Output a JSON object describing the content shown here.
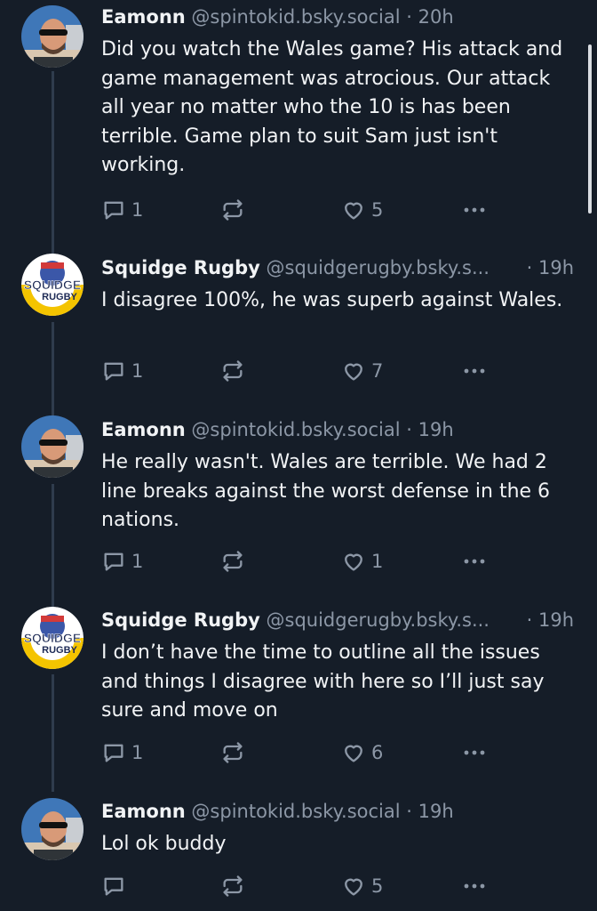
{
  "colors": {
    "background": "#151d28",
    "text": "#f1f3f5",
    "muted": "#8c97a6",
    "thread_line": "#2f3c4d"
  },
  "posts": [
    {
      "author": "Eamonn",
      "handle": "@spintokid.bsky.social",
      "sep": "·",
      "time": "20h",
      "text": "Did you watch the Wales game? His attack and game management was atrocious. Our attack all year no matter who the 10 is has been terrible. Game plan to suit Sam just isn't working.",
      "replies": "1",
      "reposts": "",
      "likes": "5",
      "avatar": "eamonn-avatar"
    },
    {
      "author": "Squidge Rugby",
      "handle": "@squidgerugby.bsky.s...",
      "sep": "·",
      "time": "19h",
      "text": "I disagree 100%, he was superb against Wales.",
      "replies": "1",
      "reposts": "",
      "likes": "7",
      "avatar": "squidge-logo-avatar",
      "avatar_text": [
        "SQUIDGE",
        "RUGBY"
      ]
    },
    {
      "author": "Eamonn",
      "handle": "@spintokid.bsky.social",
      "sep": "·",
      "time": "19h",
      "text": "He really wasn't. Wales are terrible. We had 2 line breaks against the worst defense in the 6 nations.",
      "replies": "1",
      "reposts": "",
      "likes": "1",
      "avatar": "eamonn-avatar"
    },
    {
      "author": "Squidge Rugby",
      "handle": "@squidgerugby.bsky.s...",
      "sep": "·",
      "time": "19h",
      "text": "I don’t have the time to outline all the issues and things I disagree with here so I’ll just say sure and move on",
      "replies": "1",
      "reposts": "",
      "likes": "6",
      "avatar": "squidge-logo-avatar",
      "avatar_text": [
        "SQUIDGE",
        "RUGBY"
      ]
    },
    {
      "author": "Eamonn",
      "handle": "@spintokid.bsky.social",
      "sep": "·",
      "time": "19h",
      "text": "Lol ok buddy",
      "replies": "",
      "reposts": "",
      "likes": "5",
      "avatar": "eamonn-avatar"
    }
  ],
  "icons": {
    "reply": "reply-icon",
    "repost": "repost-icon",
    "like": "heart-icon",
    "more": "more-icon"
  }
}
